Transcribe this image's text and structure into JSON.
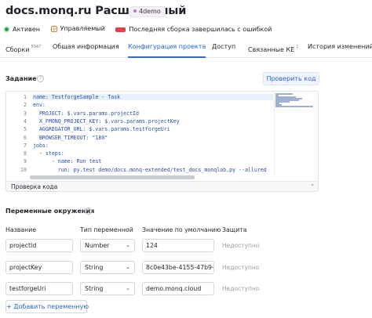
{
  "header": {
    "title": "docs.monq.ru Расширенный",
    "tag": "4demo"
  },
  "status": {
    "active": "Активен",
    "managed": "Управляемый",
    "last_build": "Последняя сборка завершилась с ошибкой"
  },
  "tabs": [
    {
      "label": "Сборки",
      "count": "5047"
    },
    {
      "label": "Общая информация"
    },
    {
      "label": "Конфигурация проекта"
    },
    {
      "label": "Доступ"
    },
    {
      "label": "Связанные КЕ",
      "count": "1"
    },
    {
      "label": "История изменений"
    }
  ],
  "task": {
    "label": "Задание",
    "check_button": "Проверить код",
    "footer": "Проверка кода",
    "line_numbers": [
      "1",
      "2",
      "3",
      "4",
      "5",
      "6",
      "7",
      "8",
      "9",
      "10"
    ],
    "code_lines": [
      "name: TestforgeSample - Task",
      "env:",
      "  PROJECT: $.vars.params.projectId",
      "  X_FMONQ_PROJECT_KEY: $.vars.params.projectKey",
      "  AGGREGATOR_URL: $.vars.params.testforgeUri",
      "  BROWSER_TIMEOUT: \"180\"",
      "jobs:",
      "  - steps:",
      "      - name: Run test",
      "        run: py.test demo/docs.monq-extended/test_docs_monqlab.py --allured"
    ]
  },
  "env": {
    "label": "Переменные окружения",
    "columns": {
      "name": "Название",
      "type": "Тип переменной",
      "default": "Значение по умолчанию",
      "access": "Защита"
    },
    "rows": [
      {
        "name": "projectId",
        "type": "Number",
        "default": "124",
        "access": "Недоступно"
      },
      {
        "name": "projectKey",
        "type": "String",
        "default": "8c0e43be-4155-47b9-",
        "access": "Недоступно"
      },
      {
        "name": "testforgeUri",
        "type": "String",
        "default": "demo.monq.cloud",
        "access": "Недоступно"
      }
    ],
    "add_button": "+ Добавить переменную"
  }
}
